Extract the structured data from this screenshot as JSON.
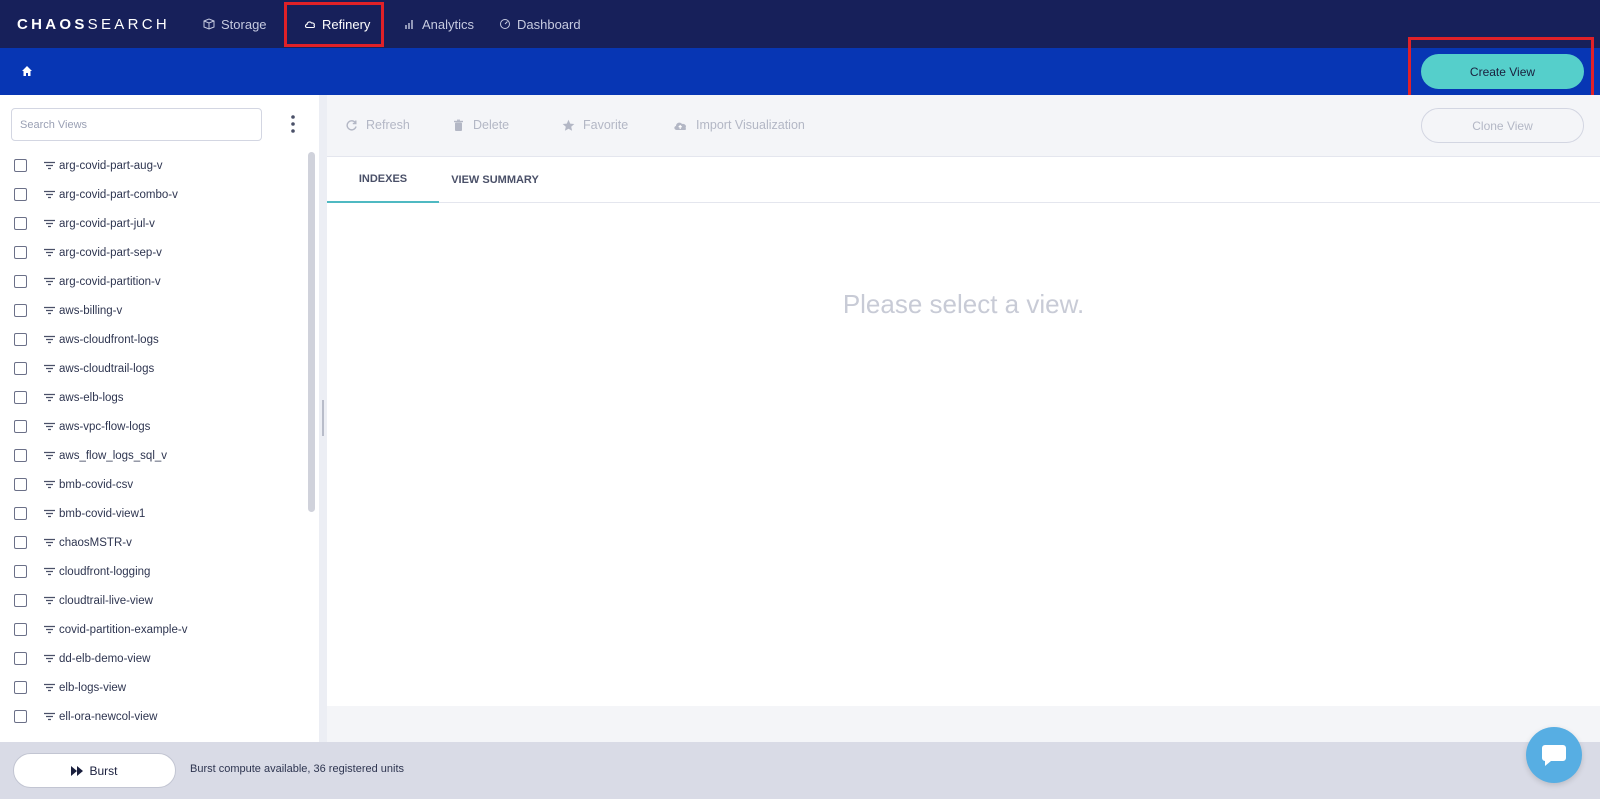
{
  "app": {
    "logo_bold": "CHAOS",
    "logo_thin": "SEARCH"
  },
  "nav": {
    "items": [
      {
        "label": "Storage",
        "icon": "storage-icon"
      },
      {
        "label": "Refinery",
        "icon": "cloud-icon",
        "active": true
      },
      {
        "label": "Analytics",
        "icon": "bar-chart-icon"
      },
      {
        "label": "Dashboard",
        "icon": "dashboard-icon"
      }
    ]
  },
  "header": {
    "home_icon": "home-icon",
    "create_view_label": "Create View"
  },
  "sidebar": {
    "search_placeholder": "Search Views",
    "search_value": "",
    "views": [
      "arg-covid-part-aug-v",
      "arg-covid-part-combo-v",
      "arg-covid-part-jul-v",
      "arg-covid-part-sep-v",
      "arg-covid-partition-v",
      "aws-billing-v",
      "aws-cloudfront-logs",
      "aws-cloudtrail-logs",
      "aws-elb-logs",
      "aws-vpc-flow-logs",
      "aws_flow_logs_sql_v",
      "bmb-covid-csv",
      "bmb-covid-view1",
      "chaosMSTR-v",
      "cloudfront-logging",
      "cloudtrail-live-view",
      "covid-partition-example-v",
      "dd-elb-demo-view",
      "elb-logs-view",
      "ell-ora-newcol-view"
    ]
  },
  "toolbar": {
    "refresh_label": "Refresh",
    "delete_label": "Delete",
    "favorite_label": "Favorite",
    "import_label": "Import Visualization",
    "clone_label": "Clone View"
  },
  "tabs": {
    "indexes_label": "INDEXES",
    "summary_label": "VIEW SUMMARY"
  },
  "main": {
    "empty_message": "Please select a view."
  },
  "footer": {
    "burst_label": "Burst",
    "burst_status": "Burst compute available, 36 registered units"
  },
  "colors": {
    "top_nav": "#17205a",
    "blue_bar": "#0736b4",
    "accent_teal": "#55cfcb",
    "highlight_red": "#e02128"
  }
}
